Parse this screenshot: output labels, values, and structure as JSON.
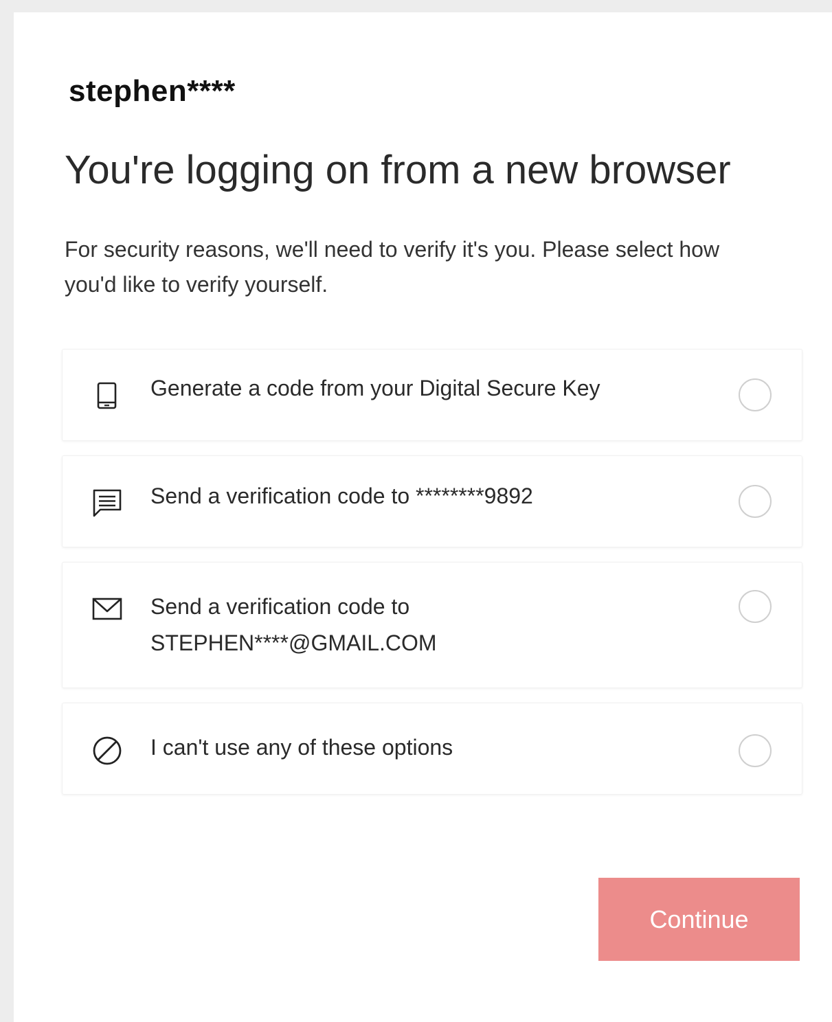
{
  "account": {
    "username": "stephen****"
  },
  "page": {
    "heading": "You're logging on from a new browser",
    "description": "For security reasons, we'll need to verify it's you. Please select how you'd like to verify yourself."
  },
  "options": [
    {
      "icon": "mobile-device-icon",
      "label": "Generate a code from your Digital Secure Key",
      "label_sub": ""
    },
    {
      "icon": "message-icon",
      "label": "Send a verification code to ********9892",
      "label_sub": ""
    },
    {
      "icon": "envelope-icon",
      "label": "Send a verification code to",
      "label_sub": "STEPHEN****@GMAIL.COM"
    },
    {
      "icon": "prohibited-icon",
      "label": "I can't use any of these options",
      "label_sub": ""
    }
  ],
  "actions": {
    "continue_label": "Continue"
  },
  "colors": {
    "accent_disabled": "#ec8c8b",
    "radio_border": "#cfcfcf"
  }
}
